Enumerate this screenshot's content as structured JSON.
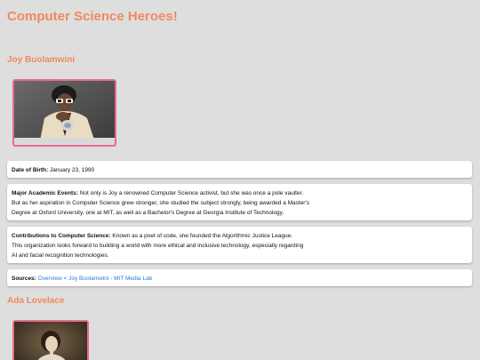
{
  "page": {
    "title": "Computer Science Heroes!"
  },
  "heroes": [
    {
      "name": "Joy Buolamwini",
      "dob_label": "Date of Birth:",
      "dob_value": "January 23, 1990",
      "events_label": "Major Academic Events:",
      "events_lines": [
        "Not only is Joy a renowned Computer Science activist, but she was once a pole vaulter.",
        "But as her aspiration in Computer Science grew stronger, she studied the subject strongly, being awarded a Master's",
        "Degree at Oxford University, one at MIT, as well as a Bachelor's Degree at Georgia Institute of Technology."
      ],
      "contrib_label": "Contributions to Computer Science:",
      "contrib_lines": [
        "Known as a poet of code, she founded the Algorithmic Justice League.",
        "This organization looks forward to building a world with more ethical and inclusive technology, especially regarding",
        "AI and facial recognition technologies."
      ],
      "sources_label": "Sources:",
      "sources_link": "Overview < Joy Buolamwini - MIT Media Lab"
    },
    {
      "name": "Ada Lovelace"
    }
  ],
  "colors": {
    "heading": "#f08a5d",
    "frame": "#e86b8a",
    "link": "#2a7ae2",
    "background": "#dedede"
  }
}
